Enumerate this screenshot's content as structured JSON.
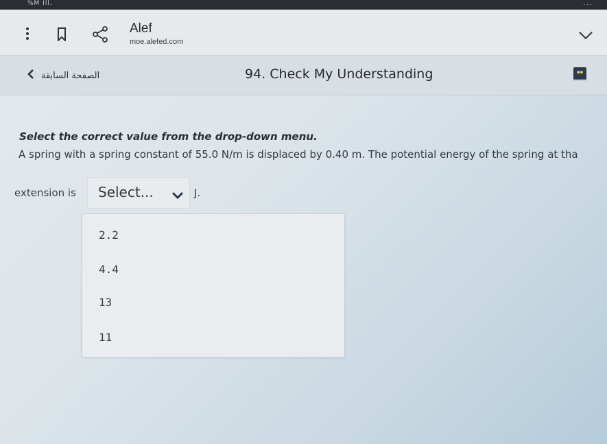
{
  "status_bar": {
    "left_text": "%M Ill.",
    "right_text": "..."
  },
  "browser": {
    "site_title": "Alef",
    "site_url": "moe.alefed.com"
  },
  "page_nav": {
    "back_label": "الصفحة السابقة",
    "heading": "94. Check My Understanding"
  },
  "question": {
    "instruction": "Select the correct value from the drop-down menu.",
    "text": "A spring with a spring constant of 55.0 N/m is displaced by 0.40 m. The potential energy of the spring at tha",
    "lead_text": "extension is",
    "unit_text": "J."
  },
  "select": {
    "placeholder": "Select..."
  },
  "dropdown": {
    "options": [
      "2.2",
      "4.4",
      "13",
      "11"
    ]
  },
  "colors": {
    "badge_bg": "#2e3a4c",
    "badge_accent": "#f0d65a"
  }
}
